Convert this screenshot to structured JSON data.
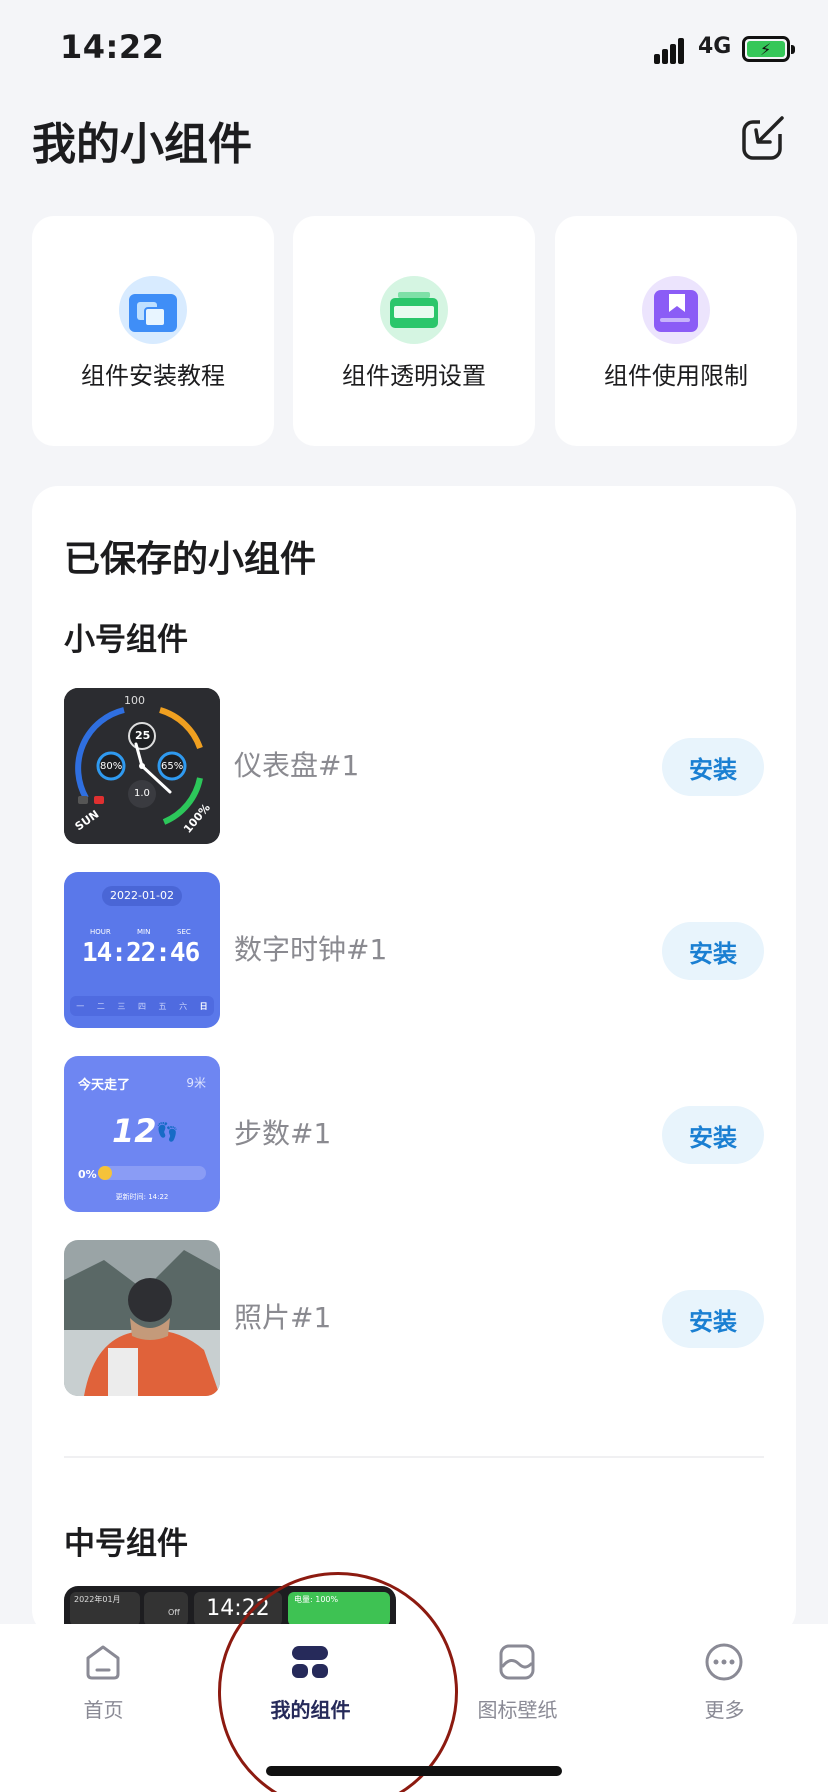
{
  "status": {
    "time": "14:22",
    "network": "4G"
  },
  "header": {
    "title": "我的小组件",
    "exit_icon": "exit-arrow-icon"
  },
  "quick_actions": [
    {
      "label": "组件安装教程",
      "icon": "install-guide-icon",
      "color": "#3f8ef7"
    },
    {
      "label": "组件透明设置",
      "icon": "transparency-icon",
      "color": "#2bc66b"
    },
    {
      "label": "组件使用限制",
      "icon": "bookmark-limit-icon",
      "color": "#8b5cf6"
    }
  ],
  "saved": {
    "title": "已保存的小组件",
    "small_title": "小号组件",
    "medium_title": "中号组件",
    "install_label": "安装",
    "items": [
      {
        "name": "仪表盘#1",
        "thumb": "dashboard"
      },
      {
        "name": "数字时钟#1",
        "thumb": "digital-clock"
      },
      {
        "name": "步数#1",
        "thumb": "steps"
      },
      {
        "name": "照片#1",
        "thumb": "photo"
      }
    ]
  },
  "thumbs": {
    "dashboard": {
      "top": "100",
      "center": "25",
      "left_pct": "80%",
      "right_pct": "65%",
      "inner": "1.0",
      "day": "SUN",
      "battery": "100%"
    },
    "digital_clock": {
      "date": "2022-01-02",
      "hour_label": "HOUR",
      "min_label": "MIN",
      "sec_label": "SEC",
      "time": "14:22:46",
      "weekdays": [
        "一",
        "二",
        "三",
        "四",
        "五",
        "六",
        "日"
      ]
    },
    "steps": {
      "title": "今天走了",
      "distance": "9米",
      "count": "12",
      "pct": "0%",
      "updated": "更新时间: 14:22"
    },
    "medium": {
      "date": "2022年01月",
      "wifi": "Off",
      "time": "14:22",
      "battery": "电量: 100%"
    }
  },
  "tabs": [
    {
      "label": "首页",
      "icon": "home-icon",
      "active": false
    },
    {
      "label": "我的组件",
      "icon": "widgets-icon",
      "active": true
    },
    {
      "label": "图标壁纸",
      "icon": "wallpaper-icon",
      "active": false
    },
    {
      "label": "更多",
      "icon": "more-icon",
      "active": false
    }
  ],
  "colors": {
    "accent": "#1a7fd2",
    "tab_active": "#262a5a",
    "clock_bg": "#5a78ea",
    "steps_bg": "#6e86f2"
  }
}
